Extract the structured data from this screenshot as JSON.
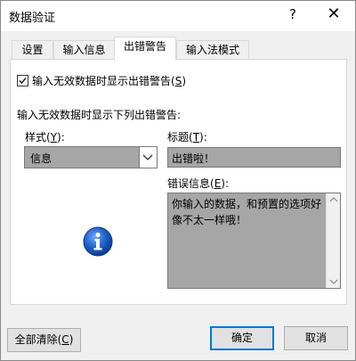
{
  "window": {
    "title": "数据验证",
    "help": "?",
    "close": "✕"
  },
  "tabs": [
    {
      "label": "设置"
    },
    {
      "label": "输入信息"
    },
    {
      "label": "出错警告"
    },
    {
      "label": "输入法模式"
    }
  ],
  "error_tab": {
    "show_alert_checkbox": {
      "checked": true,
      "label_prefix": "输入无效数据时显示出错警告(",
      "label_key": "S",
      "label_suffix": ")"
    },
    "section_label": "输入无效数据时显示下列出错警告:",
    "style": {
      "label_prefix": "样式(",
      "label_key": "Y",
      "label_suffix": "):",
      "value": "信息"
    },
    "title": {
      "label_prefix": "标题(",
      "label_key": "T",
      "label_suffix": "):",
      "value": "出错啦！"
    },
    "error_message": {
      "label_prefix": "错误信息(",
      "label_key": "E",
      "label_suffix": "):",
      "value": "你输入的数据，和预置的选项好像不太一样哦！"
    },
    "icon": "info-icon"
  },
  "footer": {
    "clear_prefix": "全部清除(",
    "clear_key": "C",
    "clear_suffix": ")",
    "ok": "确定",
    "cancel": "取消"
  },
  "colors": {
    "accent": "#0078d7",
    "field_bg": "#a6a6a6",
    "info_blue": "#1c5ec8"
  }
}
